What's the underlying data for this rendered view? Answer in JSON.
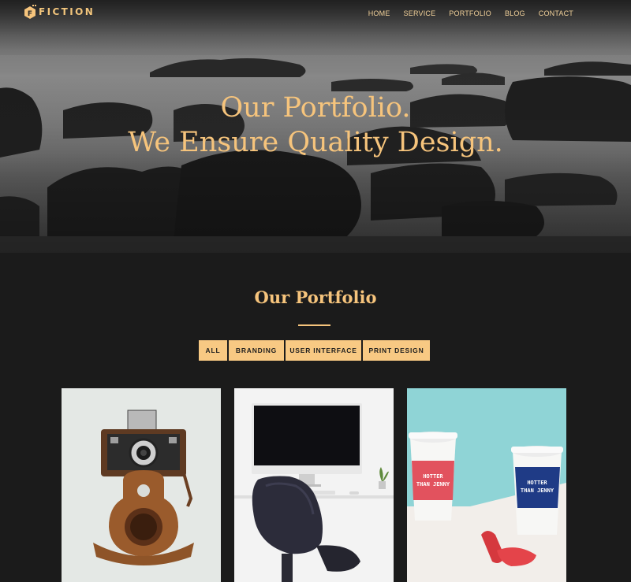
{
  "brand": {
    "letter": "F",
    "name": "FICTION",
    "accent": "#f6c47c"
  },
  "nav": [
    {
      "label": "HOME"
    },
    {
      "label": "SERVICE"
    },
    {
      "label": "PORTFOLIO"
    },
    {
      "label": "BLOG"
    },
    {
      "label": "CONTACT"
    }
  ],
  "hero": {
    "line1": "Our Portfolio.",
    "line2": "We Ensure Quality Design."
  },
  "portfolio": {
    "title": "Our Portfolio",
    "filters": [
      {
        "label": "ALL"
      },
      {
        "label": "BRANDING"
      },
      {
        "label": "USER INTERFACE"
      },
      {
        "label": "PRINT DESIGN"
      }
    ],
    "cards": [
      {
        "name": "vintage-camera-photo"
      },
      {
        "name": "desk-monitor-photo"
      },
      {
        "name": "coffee-cups-photo",
        "cup_text_1": "HOTTER THAN JENNY",
        "cup_text_2": "HOTTER THAN JENNY"
      }
    ]
  }
}
